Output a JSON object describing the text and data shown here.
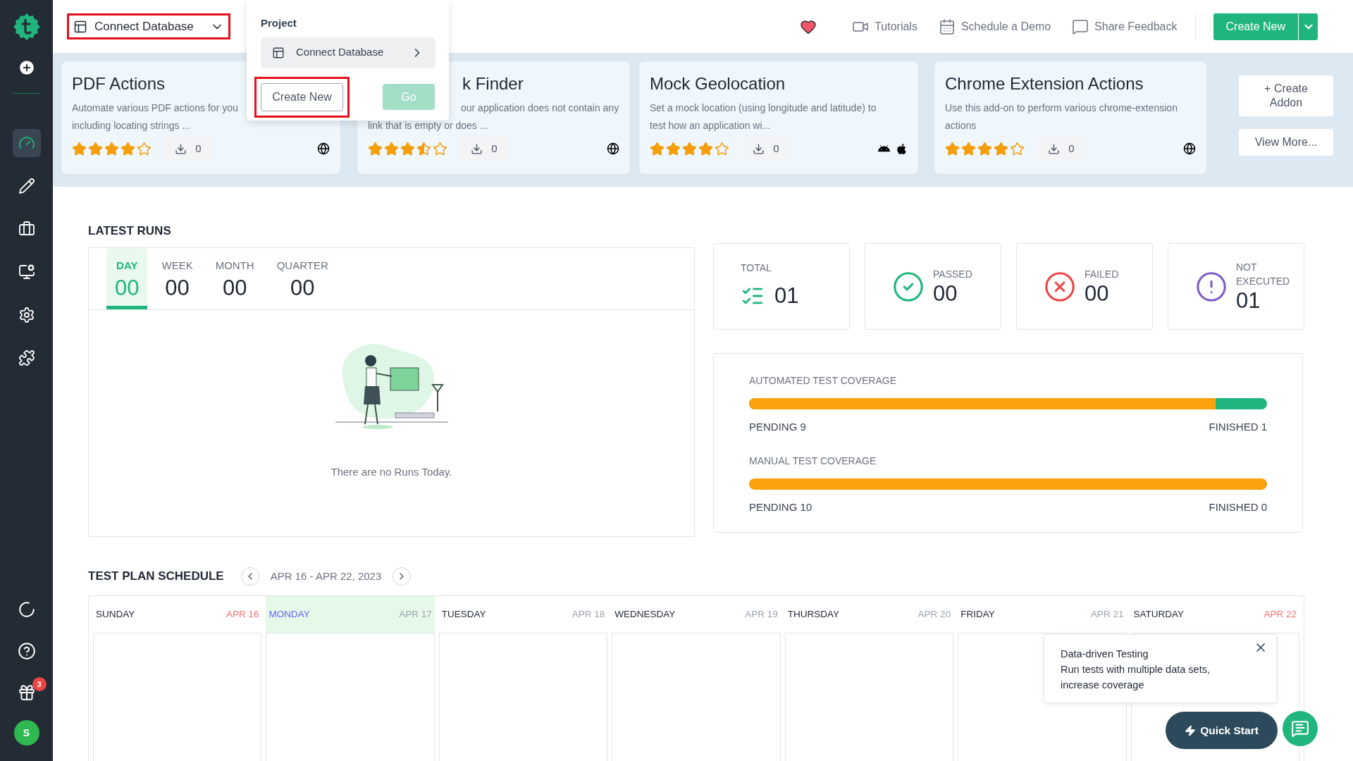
{
  "sidebar": {
    "items": [
      {
        "kind": "add",
        "selected": false
      },
      {
        "kind": "dashboard",
        "selected": true
      },
      {
        "kind": "edit",
        "selected": false
      },
      {
        "kind": "briefcase",
        "selected": false
      },
      {
        "kind": "monitor",
        "selected": false
      },
      {
        "kind": "settings",
        "selected": false
      },
      {
        "kind": "addons",
        "selected": false
      }
    ],
    "bottom_items": [
      {
        "kind": "progress"
      },
      {
        "kind": "help"
      },
      {
        "kind": "gift",
        "badge": "3"
      }
    ],
    "avatar": "S"
  },
  "project_selector": {
    "label": "Connect Database"
  },
  "project_menu": {
    "heading": "Project",
    "item": "Connect Database",
    "create_button": "Create New",
    "go_button": {
      "label": "Go",
      "disabled": true
    }
  },
  "header_links": [
    {
      "kind": "favorite"
    },
    {
      "kind": "video",
      "label": "Tutorials"
    },
    {
      "kind": "calendar",
      "label": "Schedule a Demo"
    },
    {
      "kind": "feedback",
      "label": "Share Feedback"
    }
  ],
  "create_button": "Create New",
  "addons": [
    {
      "title": "PDF Actions",
      "description_lines": [
        "Automate various PDF actions for you",
        "including locating strings ..."
      ],
      "stars": 4,
      "downloads": "0",
      "platforms": [
        {
          "kind": "web"
        }
      ]
    },
    {
      "title": "k Finder",
      "description_lines": [
        "our application does not contain any",
        "link that is empty or does ..."
      ],
      "stars": 3.5,
      "downloads": "0",
      "platforms": [
        {
          "kind": "web"
        }
      ]
    },
    {
      "title": "Mock Geolocation",
      "description_lines": [
        "Set a mock location (using longitude and latitude) to",
        "test how an application wi..."
      ],
      "stars": 4,
      "downloads": "0",
      "platforms": [
        {
          "kind": "android"
        },
        {
          "kind": "ios"
        }
      ]
    },
    {
      "title": "Chrome Extension Actions",
      "description_lines": [
        "Use this add-on to perform various chrome-extension",
        "actions"
      ],
      "stars": 4,
      "downloads": "0",
      "platforms": [
        {
          "kind": "web"
        }
      ]
    }
  ],
  "addon_actions": [
    "+ Create Addon",
    "View More..."
  ],
  "latest_runs": {
    "title": "LATEST RUNS",
    "tabs": [
      {
        "label": "DAY",
        "count": "00",
        "selected": true
      },
      {
        "label": "WEEK",
        "count": "00",
        "selected": false
      },
      {
        "label": "MONTH",
        "count": "00",
        "selected": false
      },
      {
        "label": "QUARTER",
        "count": "00",
        "selected": false
      }
    ],
    "empty_text": "There are no Runs Today."
  },
  "stats": [
    {
      "kind": "total",
      "label": "TOTAL",
      "value": "01"
    },
    {
      "kind": "passed",
      "label": "PASSED",
      "value": "00"
    },
    {
      "kind": "failed",
      "label": "FAILED",
      "value": "00"
    },
    {
      "kind": "not_executed",
      "label": "NOT EXECUTED",
      "value": "01"
    }
  ],
  "coverage": [
    {
      "label": "AUTOMATED TEST COVERAGE",
      "level": 0.9,
      "pending": "PENDING 9",
      "finished": "FINISHED 1"
    },
    {
      "label": "MANUAL TEST COVERAGE",
      "level": 1,
      "pending": "PENDING 10",
      "finished": "FINISHED 0"
    }
  ],
  "schedule": {
    "title": "TEST PLAN SCHEDULE",
    "range": "APR 16 - APR 22, 2023",
    "days": [
      {
        "name": "SUNDAY",
        "date": "APR 16",
        "selected": false,
        "weekend": true
      },
      {
        "name": "MONDAY",
        "date": "APR 17",
        "selected": true,
        "weekend": false
      },
      {
        "name": "TUESDAY",
        "date": "APR 18",
        "selected": false,
        "weekend": false
      },
      {
        "name": "WEDNESDAY",
        "date": "APR 19",
        "selected": false,
        "weekend": false
      },
      {
        "name": "THURSDAY",
        "date": "APR 20",
        "selected": false,
        "weekend": false
      },
      {
        "name": "FRIDAY",
        "date": "APR 21",
        "selected": false,
        "weekend": false
      },
      {
        "name": "SATURDAY",
        "date": "APR 22",
        "selected": false,
        "weekend": true
      }
    ]
  },
  "tooltip": {
    "title": "Data-driven Testing",
    "text": "Run tests with multiple data sets, increase coverage"
  },
  "quick_start": "Quick Start"
}
